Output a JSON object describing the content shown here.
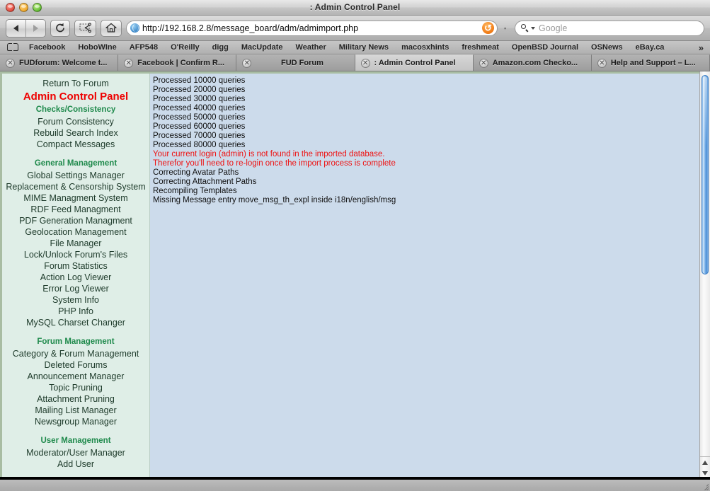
{
  "window": {
    "title": ": Admin Control Panel",
    "traffic_lights": [
      "close",
      "minimize",
      "zoom"
    ]
  },
  "toolbar": {
    "back_label": "Back",
    "forward_label": "Forward",
    "reload_label": "↻",
    "snip_label": "✂",
    "home_label": "⌂",
    "url": "http://192.168.2.8/message_board/adm/admimport.php",
    "url_reload_label": "↺",
    "url_separator": "▪",
    "search_placeholder": "Google"
  },
  "bookmarks": {
    "overflow_label": "»",
    "items": [
      "Facebook",
      "HoboWIne",
      "AFP548",
      "O'Reilly",
      "digg",
      "MacUpdate",
      "Weather",
      "Military News",
      "macosxhints",
      "freshmeat",
      "OpenBSD Journal",
      "OSNews",
      "eBay.ca"
    ]
  },
  "tabs": {
    "close_glyph": "✕",
    "items": [
      {
        "label": "FUDforum: Welcome t...",
        "active": false,
        "centered": false
      },
      {
        "label": "Facebook | Confirm R...",
        "active": false,
        "centered": false
      },
      {
        "label": "FUD Forum",
        "active": false,
        "centered": true
      },
      {
        "label": ": Admin Control Panel",
        "active": true,
        "centered": false
      },
      {
        "label": "Amazon.com Checko...",
        "active": false,
        "centered": false
      },
      {
        "label": "Help and Support – L...",
        "active": false,
        "centered": false
      }
    ]
  },
  "sidebar": {
    "items": [
      {
        "label": "Return To Forum",
        "kind": "link"
      },
      {
        "label": "Admin Control Panel",
        "kind": "title"
      },
      {
        "label": "Checks/Consistency",
        "kind": "section"
      },
      {
        "label": "Forum Consistency",
        "kind": "link"
      },
      {
        "label": "Rebuild Search Index",
        "kind": "link"
      },
      {
        "label": "Compact Messages",
        "kind": "link"
      },
      {
        "label": "",
        "kind": "spacer"
      },
      {
        "label": "General Management",
        "kind": "section"
      },
      {
        "label": "Global Settings Manager",
        "kind": "link"
      },
      {
        "label": "Replacement & Censorship System",
        "kind": "link"
      },
      {
        "label": "MIME Managment System",
        "kind": "link"
      },
      {
        "label": "RDF Feed Managment",
        "kind": "link"
      },
      {
        "label": "PDF Generation Managment",
        "kind": "link"
      },
      {
        "label": "Geolocation Management",
        "kind": "link"
      },
      {
        "label": "File Manager",
        "kind": "link"
      },
      {
        "label": "Lock/Unlock Forum's Files",
        "kind": "link"
      },
      {
        "label": "Forum Statistics",
        "kind": "link"
      },
      {
        "label": "Action Log Viewer",
        "kind": "link"
      },
      {
        "label": "Error Log Viewer",
        "kind": "link"
      },
      {
        "label": "System Info",
        "kind": "link"
      },
      {
        "label": "PHP Info",
        "kind": "link"
      },
      {
        "label": "MySQL Charset Changer",
        "kind": "link"
      },
      {
        "label": "",
        "kind": "spacer"
      },
      {
        "label": "Forum Management",
        "kind": "section"
      },
      {
        "label": "Category & Forum Management",
        "kind": "link"
      },
      {
        "label": "Deleted Forums",
        "kind": "link"
      },
      {
        "label": "Announcement Manager",
        "kind": "link"
      },
      {
        "label": "Topic Pruning",
        "kind": "link"
      },
      {
        "label": "Attachment Pruning",
        "kind": "link"
      },
      {
        "label": "Mailing List Manager",
        "kind": "link"
      },
      {
        "label": "Newsgroup Manager",
        "kind": "link"
      },
      {
        "label": "",
        "kind": "spacer"
      },
      {
        "label": "User Management",
        "kind": "section"
      },
      {
        "label": "Moderator/User Manager",
        "kind": "link"
      },
      {
        "label": "Add User",
        "kind": "link"
      }
    ]
  },
  "content": {
    "lines": [
      {
        "text": "Processed 10000 queries",
        "error": false
      },
      {
        "text": "Processed 20000 queries",
        "error": false
      },
      {
        "text": "Processed 30000 queries",
        "error": false
      },
      {
        "text": "Processed 40000 queries",
        "error": false
      },
      {
        "text": "Processed 50000 queries",
        "error": false
      },
      {
        "text": "Processed 60000 queries",
        "error": false
      },
      {
        "text": "Processed 70000 queries",
        "error": false
      },
      {
        "text": "Processed 80000 queries",
        "error": false
      },
      {
        "text": "Your current login (admin) is not found in the imported database.",
        "error": true
      },
      {
        "text": "Therefor you'll need to re-login once the import process is complete",
        "error": true
      },
      {
        "text": "Correcting Avatar Paths",
        "error": false
      },
      {
        "text": "Correcting Attachment Paths",
        "error": false
      },
      {
        "text": "Recompiling Templates",
        "error": false
      },
      {
        "text": "Missing Message entry move_msg_th_expl inside i18n/english/msg",
        "error": false
      }
    ]
  },
  "scrollbar": {
    "up_label": "▲",
    "down_label": "▼"
  },
  "colors": {
    "sidebar_bg": "#dfeee7",
    "content_bg": "#ccdbeb",
    "page_frame": "#a8bda3",
    "title_red": "#ee0000",
    "section_green": "#1f8a4c",
    "error_red": "#ee1111",
    "scroll_blue": "#4e8fd4"
  }
}
